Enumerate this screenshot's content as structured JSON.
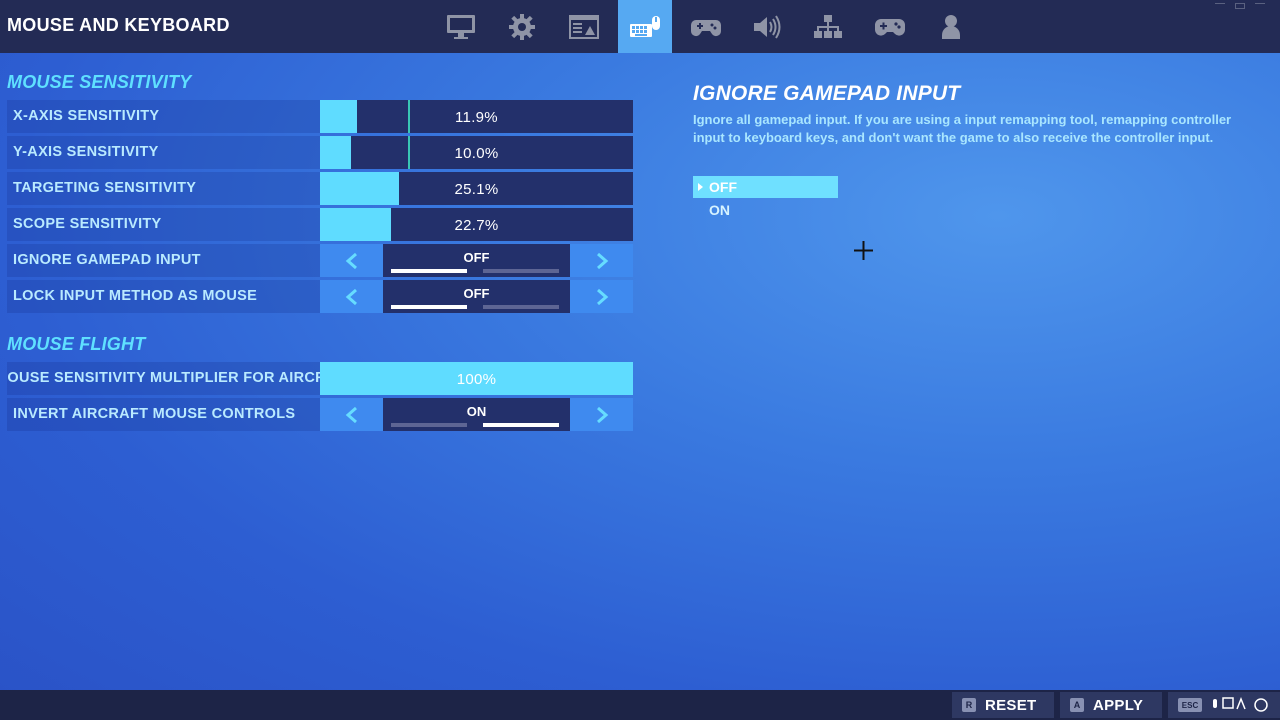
{
  "header": {
    "title": "MOUSE AND KEYBOARD",
    "tabs": [
      {
        "icon": "monitor-icon",
        "active": false
      },
      {
        "icon": "gear-icon",
        "active": false
      },
      {
        "icon": "hud-icon",
        "active": false
      },
      {
        "icon": "keyboard-mouse-icon",
        "active": true
      },
      {
        "icon": "controller-settings-icon",
        "active": false
      },
      {
        "icon": "speaker-icon",
        "active": false
      },
      {
        "icon": "network-icon",
        "active": false
      },
      {
        "icon": "gamepad-icon",
        "active": false
      },
      {
        "icon": "account-icon",
        "active": false
      }
    ]
  },
  "mouse_sensitivity": {
    "title": "MOUSE SENSITIVITY",
    "rows": [
      {
        "label": "X-AXIS SENSITIVITY",
        "value": "11.9%",
        "fill_percent": 11.9,
        "marker_percent": 28
      },
      {
        "label": "Y-AXIS SENSITIVITY",
        "value": "10.0%",
        "fill_percent": 10.0,
        "marker_percent": 28
      },
      {
        "label": "TARGETING SENSITIVITY",
        "value": "25.1%",
        "fill_percent": 25.1
      },
      {
        "label": "SCOPE SENSITIVITY",
        "value": "22.7%",
        "fill_percent": 22.7
      },
      {
        "label": "IGNORE GAMEPAD INPUT",
        "value": "OFF",
        "selected_index": 0
      },
      {
        "label": "LOCK INPUT METHOD AS MOUSE",
        "value": "OFF",
        "selected_index": 0
      }
    ]
  },
  "mouse_flight": {
    "title": "MOUSE FLIGHT",
    "rows": [
      {
        "label": "MOUSE SENSITIVITY MULTIPLIER FOR AIRCRAFT",
        "value": "100%",
        "fill_percent": 100
      },
      {
        "label": "INVERT AIRCRAFT MOUSE CONTROLS",
        "value": "ON",
        "selected_index": 1
      }
    ]
  },
  "description": {
    "title": "IGNORE GAMEPAD INPUT",
    "text": "Ignore all gamepad input.  If you are using a input remapping tool, remapping controller input to keyboard keys, and don't want the game to also receive the controller input.",
    "options": [
      "OFF",
      "ON"
    ],
    "selected": "OFF"
  },
  "footer": {
    "reset": {
      "key": "R",
      "label": "RESET"
    },
    "apply": {
      "key": "A",
      "label": "APPLY"
    },
    "back": {
      "key": "ESC"
    }
  },
  "colors": {
    "accent": "#5fdcff",
    "section_title": "#5fe0ff",
    "active_tab": "#56a9f2",
    "topbar": "#232b55"
  }
}
